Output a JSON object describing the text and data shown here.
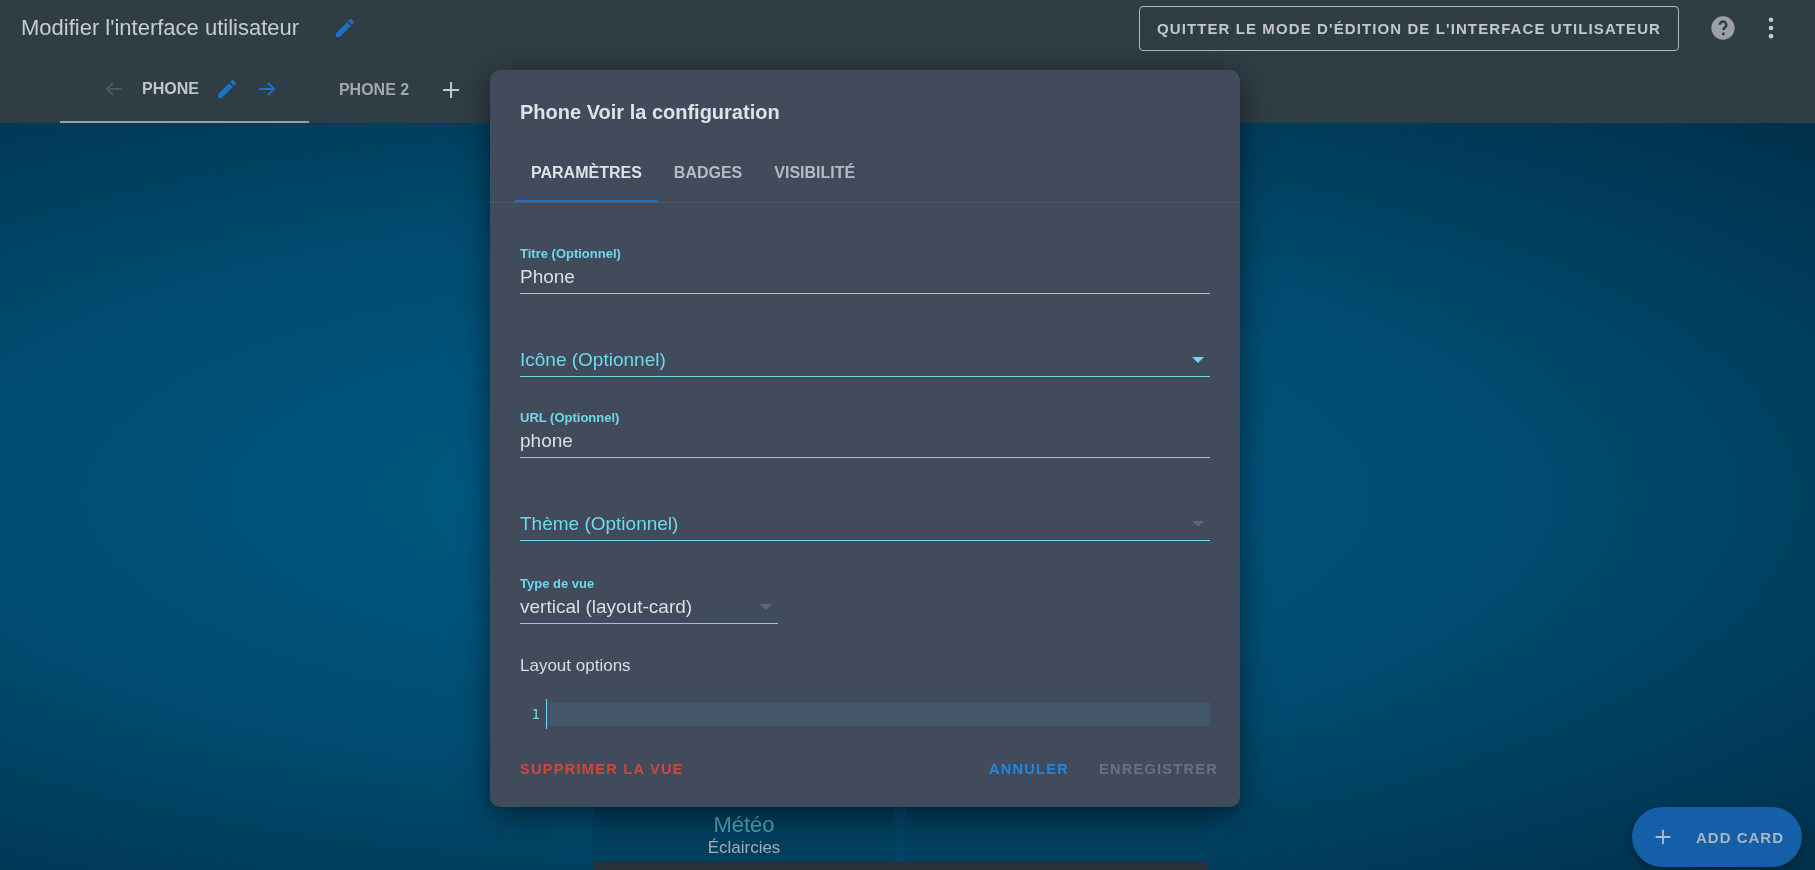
{
  "header": {
    "title": "Modifier l'interface utilisateur",
    "exit_button": "QUITTER LE MODE D'ÉDITION DE L'INTERFACE UTILISATEUR"
  },
  "views": [
    {
      "label": "PHONE",
      "selected": true
    },
    {
      "label": "PHONE 2",
      "selected": false
    }
  ],
  "background_cards": [
    {
      "kind": "weather",
      "title": "Météo",
      "subtitle": "Éclaircies"
    },
    {
      "kind": "blank"
    }
  ],
  "fab": {
    "label": "ADD CARD"
  },
  "dialog": {
    "title": "Phone Voir la configuration",
    "tabs": [
      {
        "label": "PARAMÈTRES",
        "selected": true
      },
      {
        "label": "BADGES",
        "selected": false
      },
      {
        "label": "VISIBILITÉ",
        "selected": false
      }
    ],
    "fields": [
      {
        "kind": "text",
        "label": "Titre (Optionnel)",
        "value": "Phone"
      },
      {
        "kind": "select",
        "label": "Icône (Optionnel)",
        "active": true
      },
      {
        "kind": "text",
        "label": "URL (Optionnel)",
        "value": "phone"
      },
      {
        "kind": "select",
        "label": "Thème (Optionnel)",
        "active": false
      },
      {
        "kind": "select",
        "label": "Type de vue",
        "value": "vertical (layout-card)",
        "active": false
      }
    ],
    "layout_options": {
      "label": "Layout options",
      "line_numbers": [
        "1"
      ]
    },
    "actions": [
      {
        "label": "SUPPRIMER LA VUE",
        "kind": "danger",
        "disabled": false
      },
      {
        "label": "ANNULER",
        "kind": "primary",
        "disabled": false
      },
      {
        "label": "ENREGISTRER",
        "kind": "primary",
        "disabled": true
      }
    ]
  }
}
